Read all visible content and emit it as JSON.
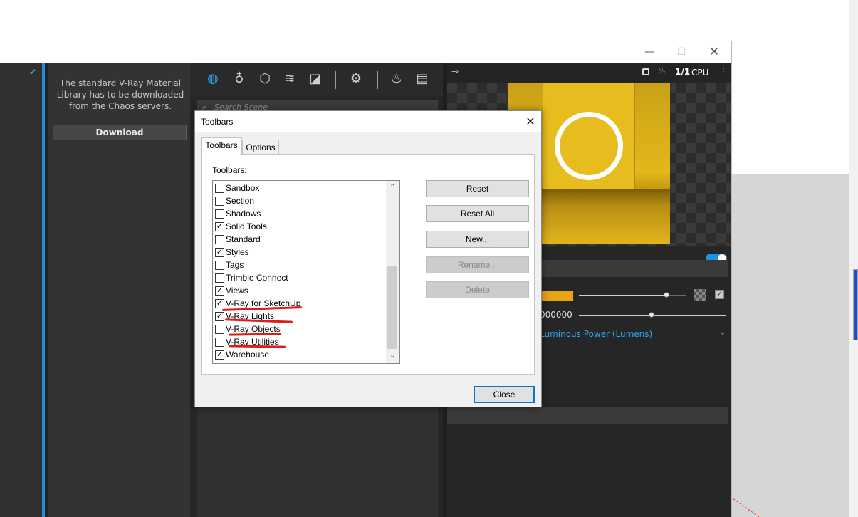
{
  "window": {
    "controls": {
      "minimize": "—",
      "maximize": "☐",
      "close": "✕"
    }
  },
  "library": {
    "message": "The standard V-Ray Material Library has to be downloaded from the Chaos servers.",
    "download_label": "Download"
  },
  "scene": {
    "search_placeholder": "Search Scene",
    "toolbar_icons": [
      "materials-icon",
      "lights-icon",
      "geometry-icon",
      "layers-icon",
      "textures-icon",
      "settings-icon",
      "teapot-render-icon",
      "frame-buffer-icon"
    ]
  },
  "render": {
    "ratio_label": "1/1",
    "engine_label": "CPU",
    "intensity_value": "000000",
    "units_label": "Luminous Power (Lumens)",
    "toggle_on": true
  },
  "dialog": {
    "title": "Toolbars",
    "close_glyph": "✕",
    "tabs": [
      {
        "label": "Toolbars",
        "active": true
      },
      {
        "label": "Options",
        "active": false
      }
    ],
    "list_label": "Toolbars:",
    "items": [
      {
        "label": "Sandbox",
        "checked": false
      },
      {
        "label": "Section",
        "checked": false
      },
      {
        "label": "Shadows",
        "checked": false
      },
      {
        "label": "Solid Tools",
        "checked": true
      },
      {
        "label": "Standard",
        "checked": false
      },
      {
        "label": "Styles",
        "checked": true
      },
      {
        "label": "Tags",
        "checked": false
      },
      {
        "label": "Trimble Connect",
        "checked": false
      },
      {
        "label": "Views",
        "checked": true
      },
      {
        "label": "V-Ray for SketchUp",
        "checked": true
      },
      {
        "label": "V-Ray Lights",
        "checked": true
      },
      {
        "label": "V-Ray Objects",
        "checked": false
      },
      {
        "label": "V-Ray Utilities",
        "checked": false
      },
      {
        "label": "Warehouse",
        "checked": true
      }
    ],
    "buttons": {
      "reset": "Reset",
      "reset_all": "Reset All",
      "new": "New...",
      "rename": "Rename...",
      "delete": "Delete",
      "close": "Close"
    }
  },
  "colors": {
    "accent": "#1f8fd8",
    "annotation_red": "#e01b1b",
    "swatch": "#e8a417"
  }
}
